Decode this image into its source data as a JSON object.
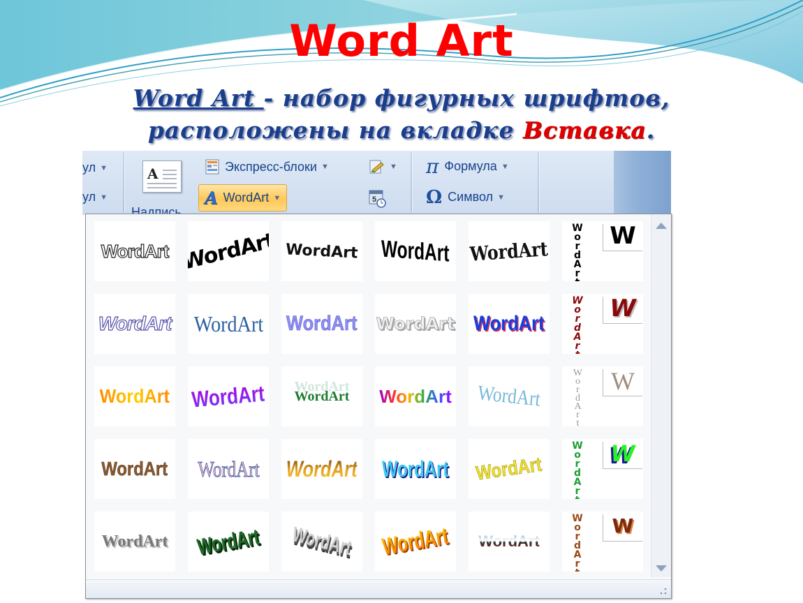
{
  "slide": {
    "title": "Word Art",
    "subtitle_link": "Word Art ",
    "subtitle_rest_1": " - набор фигурных шрифтов,",
    "subtitle_line2": "расположены на вкладке ",
    "subtitle_highlight": "Вставка",
    "subtitle_end": "."
  },
  "ribbon": {
    "cut_item_1": "ул",
    "cut_item_2": "ул",
    "textbox_label": "Надпись",
    "express_blocks": "Экспресс-блоки",
    "wordart": "WordArt",
    "formula": "Формула",
    "symbol": "Символ",
    "dropdown_arrow": "▼",
    "pi_glyph": "π",
    "omega_glyph": "Ω",
    "textbox_glyph": "A"
  },
  "gallery": {
    "sample_text": "WordArt",
    "sample_letter": "W",
    "rows": [
      [
        {
          "style": "outline-black"
        },
        {
          "style": "bold-black-rise"
        },
        {
          "style": "arch-black"
        },
        {
          "style": "condensed-black-wave"
        },
        {
          "style": "serif-black-rise"
        },
        {
          "style": "vertical-black"
        }
      ],
      [
        {
          "style": "outline-blue-italic"
        },
        {
          "style": "serif-blue"
        },
        {
          "style": "bold-lavender"
        },
        {
          "style": "silver-3d"
        },
        {
          "style": "blue-red-shadow"
        },
        {
          "style": "vertical-darkred"
        }
      ],
      [
        {
          "style": "orange-gradient"
        },
        {
          "style": "purple-gradient"
        },
        {
          "style": "green-reflection"
        },
        {
          "style": "rainbow"
        },
        {
          "style": "light-blue-arch"
        },
        {
          "style": "vertical-gray-serif"
        }
      ],
      [
        {
          "style": "brown-texture"
        },
        {
          "style": "pink-blue-arch"
        },
        {
          "style": "gold-italic"
        },
        {
          "style": "cyan-wave"
        },
        {
          "style": "yellow-wave"
        },
        {
          "style": "vertical-green-blue"
        }
      ],
      [
        {
          "style": "gray-shadow"
        },
        {
          "style": "green-3d"
        },
        {
          "style": "silver-3d-perspective"
        },
        {
          "style": "orange-3d"
        },
        {
          "style": "chrome-flat"
        },
        {
          "style": "vertical-wood"
        }
      ]
    ]
  }
}
